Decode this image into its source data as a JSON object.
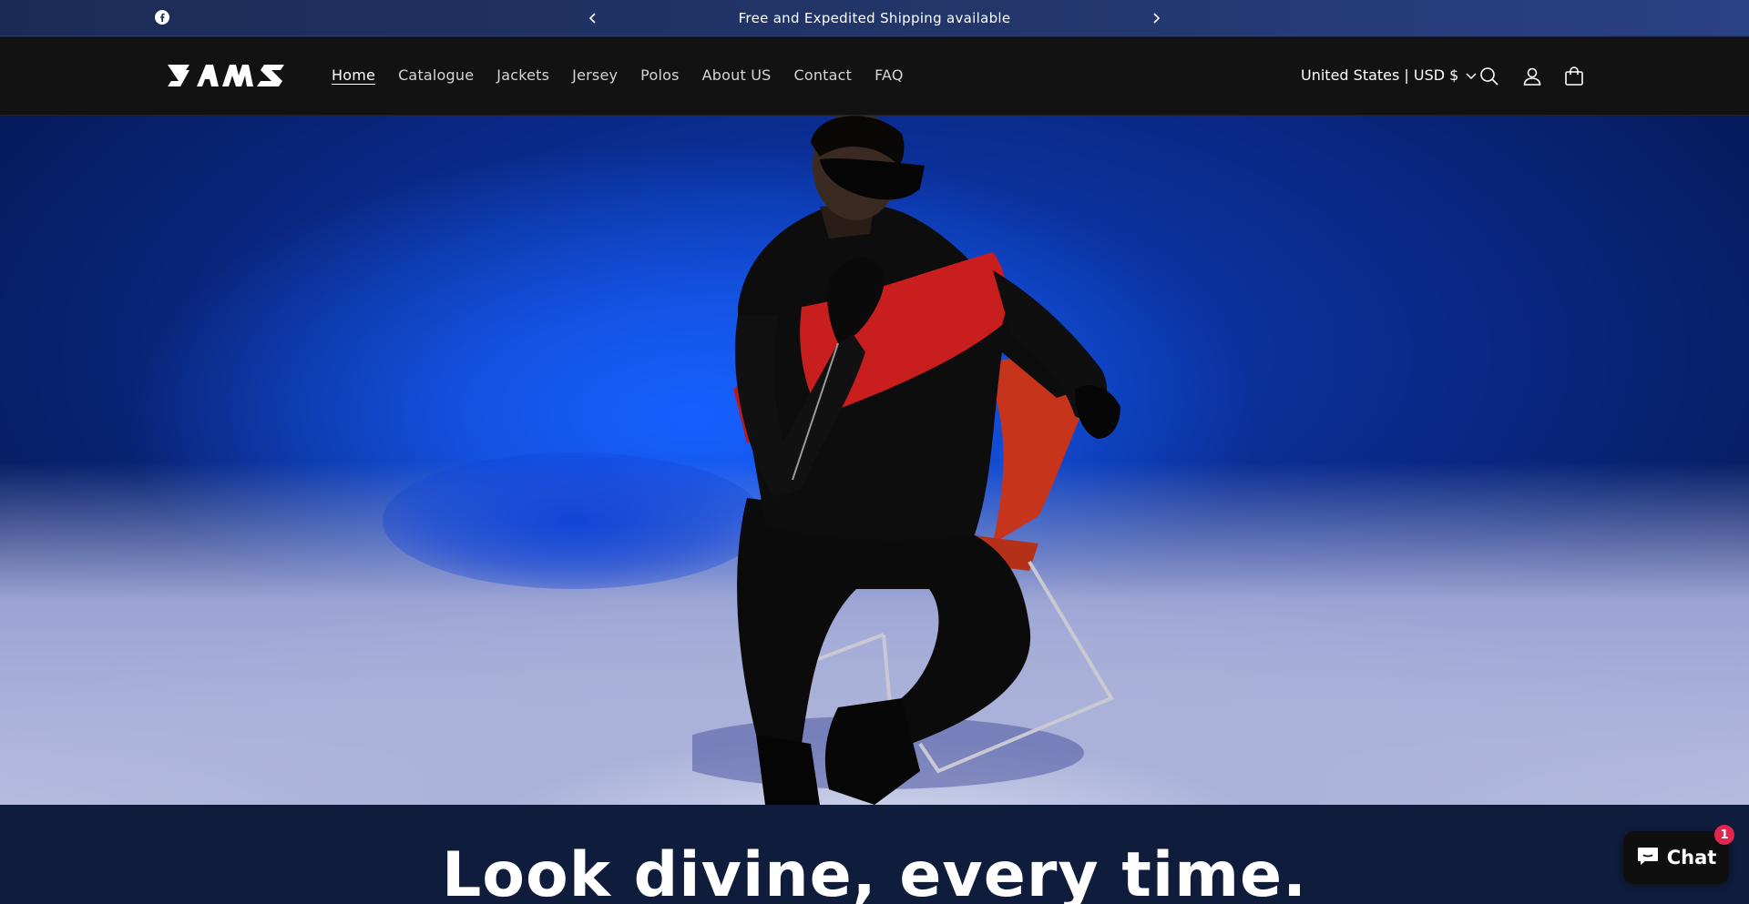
{
  "announcement": {
    "message": "Free and Expedited Shipping available",
    "social": "facebook-icon",
    "prev_icon": "chevron-left-icon",
    "next_icon": "chevron-right-icon"
  },
  "header": {
    "logo_alt": "ZAMS",
    "nav": [
      {
        "label": "Home",
        "active": true
      },
      {
        "label": "Catalogue"
      },
      {
        "label": "Jackets"
      },
      {
        "label": "Jersey"
      },
      {
        "label": "Polos"
      },
      {
        "label": "About US"
      },
      {
        "label": "Contact"
      },
      {
        "label": "FAQ"
      }
    ],
    "currency": "United States | USD $",
    "icons": [
      "search-icon",
      "account-icon",
      "cart-icon"
    ]
  },
  "hero": {
    "image": "model-seated-on-chair"
  },
  "tagline": "Look divine, every time.",
  "chat": {
    "label": "Chat",
    "badge": "1"
  },
  "colors": {
    "announcement_bg": "#23376d",
    "header_bg": "#121212",
    "section_bg": "#101c3c",
    "badge": "#e2264d"
  }
}
